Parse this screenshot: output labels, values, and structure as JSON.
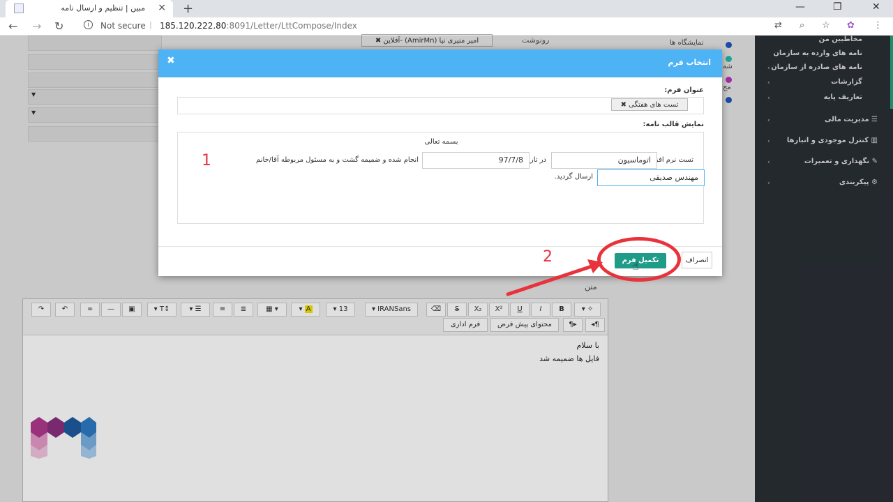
{
  "browser": {
    "tab_title": "مبین | تنظیم و ارسال نامه",
    "not_secure": "Not secure",
    "url_host": "185.120.222.80",
    "url_rest": ":8091/Letter/LttCompose/Index"
  },
  "sidebar": {
    "items": [
      {
        "label": "مخاطبین من"
      },
      {
        "label": "نامه های وارده به سازمان"
      },
      {
        "label": "نامه های صادره از سازمان"
      },
      {
        "label": "گزارشات"
      },
      {
        "label": "تعاریف پایه"
      }
    ],
    "sections": [
      {
        "label": "مدیریت مالی"
      },
      {
        "label": "کنترل موجودی و انبارها"
      },
      {
        "label": "نگهداری و تعمیرات"
      },
      {
        "label": "پیکربندی"
      }
    ]
  },
  "background": {
    "cc_label": "رونوشت",
    "cc_chip": "امیر منیری نیا (AmirMn) -آفلاین ✖",
    "reps_label": "نمایشگاه ها",
    "rep_line_2": "شه",
    "rep_line_3": "مح"
  },
  "modal": {
    "title": "انتخاب فرم",
    "close": "✖",
    "form_title_label": "عنوان فرم:",
    "form_chip": "تست های هفتگی ✖",
    "preview_label": "نمایش قالب نامه:",
    "basmala": "بسمه تعالی",
    "text_1": "تست نرم افزار",
    "input_1": "اتوماسیون",
    "text_2": "در تاریخ",
    "input_2": "97/7/8",
    "text_3": "انجام شده و ضمیمه گشت و به مسئول مربوطه آقا/خانم",
    "input_3": "مهندس صدیقی",
    "text_4": "ارسال گردید.",
    "cancel": "انصراف",
    "submit": "تکمیل فرم"
  },
  "annotations": {
    "num_1": "1",
    "num_2": "2"
  },
  "editor": {
    "label": "متن",
    "font_name": "IRANSans",
    "font_size": "13",
    "btn_default_content": "محتوای پیش فرض",
    "btn_admin_form": "فرم اداری",
    "body_line_1": "با سلام",
    "body_line_2": "فایل ها ضمیمه شد"
  },
  "colors": {
    "modal_header": "#4db3f5",
    "submit": "#1f9c88",
    "highlight": "#e8323c",
    "sidebar": "#2a2f35"
  }
}
